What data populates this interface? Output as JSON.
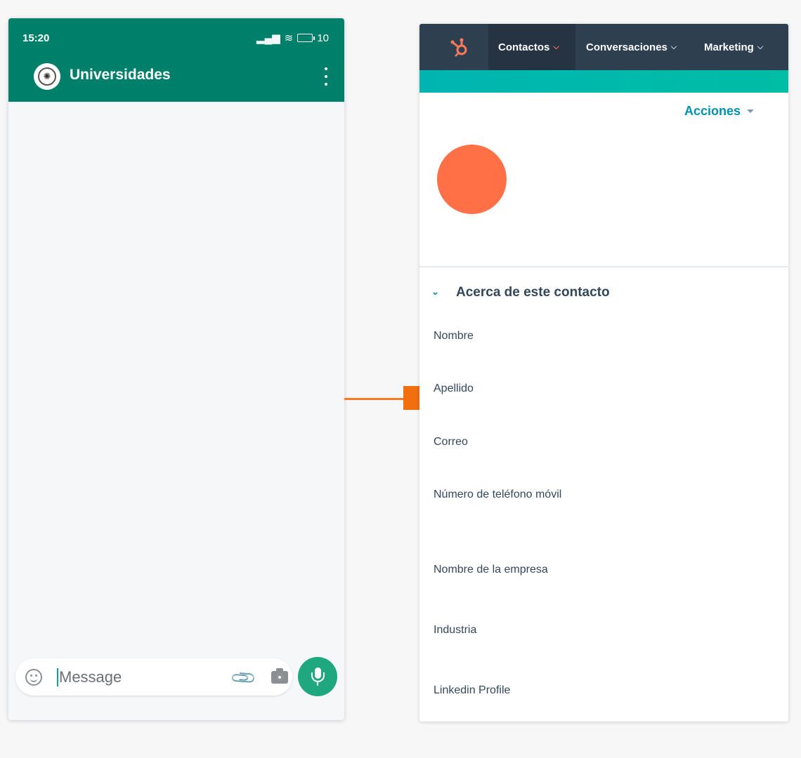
{
  "phone": {
    "status_time": "15:20",
    "status_battery": "10",
    "chat_title": "Universidades",
    "message_placeholder": "Message",
    "icons": [
      "emoji-icon",
      "attach-icon",
      "camera-icon",
      "mic-icon",
      "more-vert-icon"
    ]
  },
  "hubspot": {
    "nav": [
      {
        "label": "Contactos"
      },
      {
        "label": "Conversaciones"
      },
      {
        "label": "Marketing"
      }
    ],
    "actions_label": "Acciones",
    "section_title": "Acerca de este contacto",
    "fields": [
      "Nombre",
      "Apellido",
      "Correo",
      "Número de teléfono móvil",
      "Nombre de la empresa",
      "Industria",
      "Linkedin Profile"
    ]
  },
  "colors": {
    "whatsapp_green": "#00806a",
    "mic_green": "#1fa77f",
    "hubspot_nav": "#2e3f50",
    "hubspot_teal": "#00b5b1",
    "hubspot_orange": "#ff7047",
    "connector_orange": "#f26f10"
  }
}
